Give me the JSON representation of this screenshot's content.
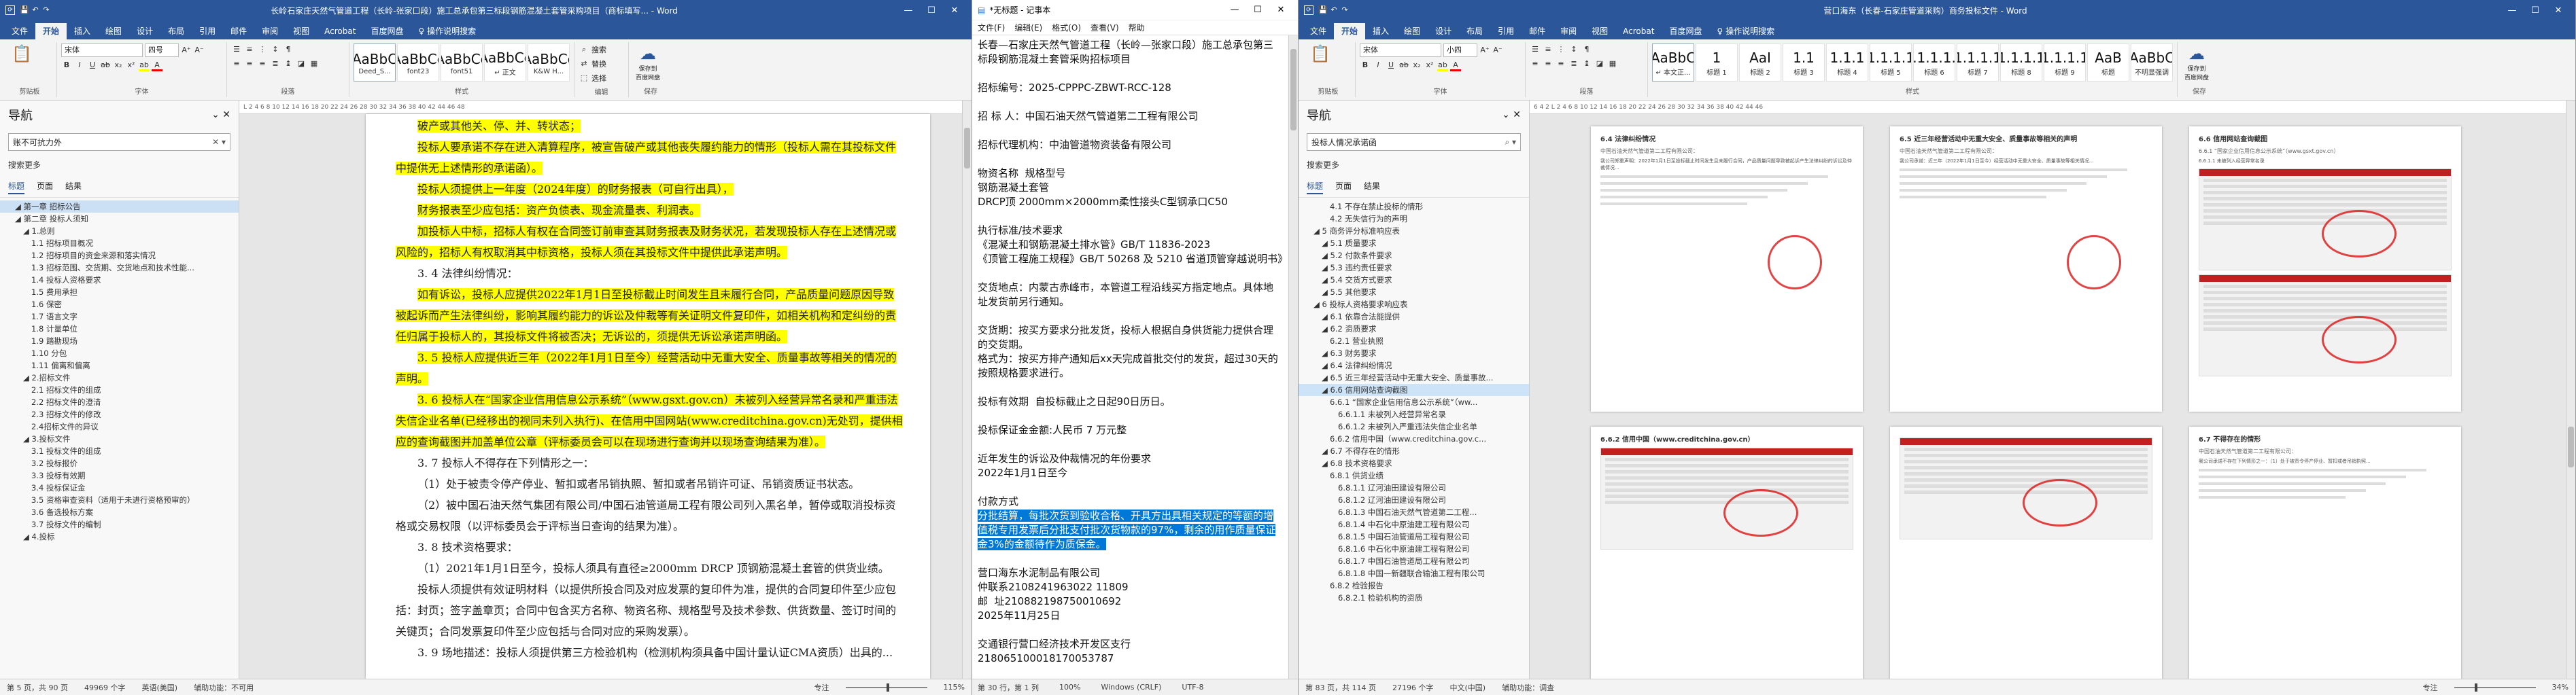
{
  "win1": {
    "title_left": "长岭石家庄天然气管道工程（长岭-张家口段）施工总承包第三标段钢筋混凝土套管采购项目（商标填写...",
    "title_right": "Word",
    "tabs": [
      "文件",
      "开始",
      "插入",
      "绘图",
      "设计",
      "布局",
      "引用",
      "邮件",
      "审阅",
      "视图",
      "Acrobat",
      "百度网盘",
      "♀ 操作说明搜索"
    ],
    "font_name": "宋体",
    "font_size": "四号",
    "styles": [
      {
        "sample": "AaBbC",
        "name": "Deed_S..."
      },
      {
        "sample": "AaBbCc",
        "name": "font23"
      },
      {
        "sample": "AaBbCc",
        "name": "font51"
      },
      {
        "sample": "AaBbCc",
        "name": "↵ 正文"
      },
      {
        "sample": "AaBbCc",
        "name": "K&W H..."
      }
    ],
    "edit": [
      "搜索",
      "替换",
      "选择"
    ],
    "save_label": "保存到\n百度网盘",
    "group_labels": [
      "剪贴板",
      "字体",
      "段落",
      "样式",
      "编辑",
      "保存"
    ],
    "nav": {
      "title": "导航",
      "search_value": "账不可抗力外",
      "search_link": "搜索更多",
      "tabs": [
        "标题",
        "页面",
        "结果"
      ],
      "tree": [
        {
          "t": "第一章 招标公告",
          "lv": 1,
          "sel": true
        },
        {
          "t": "第二章 投标人须知",
          "lv": 1
        },
        {
          "t": "1.总则",
          "lv": 2
        },
        {
          "t": "1.1 招标项目概况",
          "lv": 3
        },
        {
          "t": "1.2 招标项目的资金来源和落实情况",
          "lv": 3
        },
        {
          "t": "1.3 招标范围、交货期、交货地点和技术性能...",
          "lv": 3
        },
        {
          "t": "1.4 投标人资格要求",
          "lv": 3
        },
        {
          "t": "1.5 费用承担",
          "lv": 3
        },
        {
          "t": "1.6 保密",
          "lv": 3
        },
        {
          "t": "1.7 语言文字",
          "lv": 3
        },
        {
          "t": "1.8 计量单位",
          "lv": 3
        },
        {
          "t": "1.9 踏勘现场",
          "lv": 3
        },
        {
          "t": "1.10 分包",
          "lv": 3
        },
        {
          "t": "1.11 偏离和偏离",
          "lv": 3
        },
        {
          "t": "2.招标文件",
          "lv": 2
        },
        {
          "t": "2.1 招标文件的组成",
          "lv": 3
        },
        {
          "t": "2.2 招标文件的澄清",
          "lv": 3
        },
        {
          "t": "2.3 招标文件的修改",
          "lv": 3
        },
        {
          "t": "2.4招标文件的异议",
          "lv": 3
        },
        {
          "t": "3.投标文件",
          "lv": 2
        },
        {
          "t": "3.1 投标文件的组成",
          "lv": 3
        },
        {
          "t": "3.2 投标报价",
          "lv": 3
        },
        {
          "t": "3.3 投标有效期",
          "lv": 3
        },
        {
          "t": "3.4 投标保证金",
          "lv": 3
        },
        {
          "t": "3.5 资格审查资料（适用于未进行资格预审的）",
          "lv": 3
        },
        {
          "t": "3.6 备选投标方案",
          "lv": 3
        },
        {
          "t": "3.7 投标文件的编制",
          "lv": 3
        },
        {
          "t": "4.投标",
          "lv": 2
        }
      ]
    },
    "ruler": "L  2  4  6  8  10  12  14  16  18  20  22  24  26  28  30  32  34  36  38  40  42  44  46  48",
    "paragraphs": [
      {
        "h": "yel",
        "t": "破产或其他关、停、并、转状态；"
      },
      {
        "h": "yel",
        "t": "投标人要承诺不存在进入清算程序，被宣告破产或其他丧失履约能力的情形（投标人需在其投标文件中提供无上述情形的承诺函）。"
      },
      {
        "h": "yel",
        "t": "投标人须提供上一年度（2024年度）的财务报表（可自行出具），"
      },
      {
        "h": "yel",
        "t": "财务报表至少应包括：资产负债表、现金流量表、利润表。"
      },
      {
        "h": "yel",
        "t": "加投标人中标，招标人有权在合同签订前审查其财务报表及财务状况，若发现投标人存在上述情况或风险的，招标人有权取消其中标资格，投标人须在其投标文件中提供此承诺声明。"
      },
      {
        "h": "",
        "t": "3. 4 法律纠纷情况："
      },
      {
        "h": "yel",
        "t": "如有诉讼，投标人应提供2022年1月1日至投标截止时间发生且未履行合同，产品质量问题原因导致被起诉而产生法律纠纷，影响其履约能力的诉讼及仲裁等有关证明文件复印件，如相关机构和定纠纷的责任归属于投标人的，其投标文件将被否决；无诉讼的，须提供无诉讼承诺声明函。"
      },
      {
        "h": "yel",
        "t": "3. 5 投标人应提供近三年（2022年1月1日至今）经营活动中无重大安全、质量事故等相关的情况的声明。"
      },
      {
        "h": "yel",
        "t": "3. 6 投标人在“国家企业信用信息公示系统”（www.gsxt.gov.cn）未被列入经营异常名录和严重违法失信企业名单(已经移出的视同未列入执行)、在信用中国网站(www.creditchina.gov.cn)无处罚，提供相应的查询截图并加盖单位公章（评标委员会可以在现场进行查询并以现场查询结果为准）。"
      },
      {
        "h": "",
        "t": "3. 7 投标人不得存在下列情形之一："
      },
      {
        "h": "",
        "t": "（1）处于被责令停产停业、暂扣或者吊销执照、暂扣或者吊销许可证、吊销资质证书状态。"
      },
      {
        "h": "",
        "t": "（2）被中国石油天然气集团有限公司/中国石油管道局工程有限公司列入黑名单，暂停或取消投标资格或交易权限（以评标委员会于评标当日查询的结果为准）。"
      },
      {
        "h": "",
        "t": "3. 8 技术资格要求："
      },
      {
        "h": "",
        "t": "（1）2021年1月1日至今，投标人须具有直径≥2000mm DRCP 顶钢筋混凝土套管的供货业绩。"
      },
      {
        "h": "",
        "t": "投标人须提供有效证明材料（以提供所投合同及对应发票的复印件为准，提供的合同复印件至少应包括：封页；签字盖章页；合同中包含买方名称、物资名称、规格型号及技术参数、供货数量、签订时间的关键页；合同发票复印件至少应包括与合同对应的采购发票）。"
      },
      {
        "h": "",
        "t": "3. 9 场地描述：投标人须提供第三方检验机构（检测机构须具备中国计量认证CMA资质）出具的..."
      }
    ],
    "status": [
      "第 5 页，共 90 页",
      "49969 个字",
      "英语(美国)",
      "辅助功能：不可用",
      "专注",
      "115%"
    ]
  },
  "win2": {
    "title": "*无标题 - 记事本",
    "menu": [
      "文件(F)",
      "编辑(E)",
      "格式(O)",
      "查看(V)",
      "帮助"
    ],
    "lines": [
      {
        "t": "长春—石家庄天然气管道工程（长岭—张家口段）施工总承包第三标段钢筋混凝土套管采购招标项目"
      },
      {
        "t": ""
      },
      {
        "t": "招标编号：2025-CPPPC-ZBWT-RCC-128"
      },
      {
        "t": ""
      },
      {
        "t": "招 标 人：中国石油天然气管道第二工程有限公司"
      },
      {
        "t": ""
      },
      {
        "t": "招标代理机构：中油管道物资装备有限公司"
      },
      {
        "t": ""
      },
      {
        "t": "物资名称  规格型号"
      },
      {
        "t": "钢筋混凝土套管"
      },
      {
        "t": "DRCP顶 2000mm×2000mm柔性接头C型钢承口C50"
      },
      {
        "t": ""
      },
      {
        "t": "执行标准/技术要求"
      },
      {
        "t": "《混凝土和钢筋混凝土排水管》GB/T 11836-2023"
      },
      {
        "t": "《顶管工程施工规程》GB/T 50268 及 5210 省道顶管穿越说明书》"
      },
      {
        "t": ""
      },
      {
        "t": "交货地点：内蒙古赤峰市，本管道工程沿线买方指定地点。具体地址发货前另行通知。"
      },
      {
        "t": ""
      },
      {
        "t": "交货期：按买方要求分批发货，投标人根据自身供货能力提供合理的交货期。"
      },
      {
        "t": "格式为：按买方排产通知后xx天完成首批交付的发货，超过30天的按照规格要求进行。"
      },
      {
        "t": ""
      },
      {
        "t": "投标有效期  自投标截止之日起90日历日。"
      },
      {
        "t": ""
      },
      {
        "t": "投标保证金金额:人民币 7 万元整"
      },
      {
        "t": ""
      },
      {
        "t": "近年发生的诉讼及仲裁情况的年份要求"
      },
      {
        "t": "2022年1月1日至今"
      },
      {
        "t": ""
      },
      {
        "t": "付款方式"
      },
      {
        "t": "分批结算，每批次货到验收合格、开具方出具相关规定的等额的增值税专用发票后分批支付批次货物款的97%，剩余的用作质量保证金3%的金额待作为质保金。",
        "sel": true
      },
      {
        "t": ""
      },
      {
        "t": "营口海东水泥制品有限公司"
      },
      {
        "t": "仲联系2108241963022 11809"
      },
      {
        "t": "邮  址210882198750010692"
      },
      {
        "t": "2025年11月25日"
      },
      {
        "t": ""
      },
      {
        "t": "交通银行营口经济技术开发区支行"
      },
      {
        "t": "218065100018170053787"
      }
    ],
    "status": [
      "第 30 行，第 1 列",
      "100%",
      "Windows (CRLF)",
      "UTF-8"
    ]
  },
  "win3": {
    "title_left": "营口海东（长春-石家庄管道采购）商务投标文件",
    "title_right": "Word",
    "tabs": [
      "文件",
      "开始",
      "插入",
      "绘图",
      "设计",
      "布局",
      "引用",
      "邮件",
      "审阅",
      "视图",
      "Acrobat",
      "百度网盘",
      "♀ 操作说明搜索"
    ],
    "font_name": "宋体",
    "font_size": "小四",
    "styles": [
      {
        "sample": "AaBbC",
        "name": "↵ 本文正..."
      },
      {
        "sample": "1",
        "name": "标题 1"
      },
      {
        "sample": "AaI",
        "name": "标题 2"
      },
      {
        "sample": "1.1",
        "name": "标题 3"
      },
      {
        "sample": "1.1.1",
        "name": "标题 4"
      },
      {
        "sample": "1.1.1.1",
        "name": "标题 5"
      },
      {
        "sample": "1.1.1.1.1",
        "name": "标题 6"
      },
      {
        "sample": "1.1.1.1.1.1",
        "name": "标题 7"
      },
      {
        "sample": "1.1.1.1",
        "name": "标题 8"
      },
      {
        "sample": "1.1.1.1",
        "name": "标题 9"
      },
      {
        "sample": "AaB",
        "name": "标题"
      },
      {
        "sample": "AaBbC",
        "name": "不明显强调"
      }
    ],
    "nav": {
      "title": "导航",
      "search_value": "投标人情况承诺函",
      "search_link": "搜索更多",
      "tabs": [
        "标题",
        "页面",
        "结果"
      ],
      "tree": [
        {
          "t": "4.1 不存在禁止投标的情形",
          "lv": 3
        },
        {
          "t": "4.2 无失信行为的声明",
          "lv": 3
        },
        {
          "t": "5 商务评分标准响应表",
          "lv": 1
        },
        {
          "t": "5.1 质量要求",
          "lv": 2
        },
        {
          "t": "5.2 付款条件要求",
          "lv": 2
        },
        {
          "t": "5.3 违约责任要求",
          "lv": 2
        },
        {
          "t": "5.4 交货方式要求",
          "lv": 2
        },
        {
          "t": "5.5 其他要求",
          "lv": 2
        },
        {
          "t": "6 投标人资格要求响应表",
          "lv": 1
        },
        {
          "t": "6.1 依靠合法能提供",
          "lv": 2
        },
        {
          "t": "6.2 资质要求",
          "lv": 2
        },
        {
          "t": "6.2.1 营业执照",
          "lv": 3
        },
        {
          "t": "6.3 财务要求",
          "lv": 2
        },
        {
          "t": "6.4 法律纠纷情况",
          "lv": 2
        },
        {
          "t": "6.5 近三年经营活动中无重大安全、质量事故...",
          "lv": 2
        },
        {
          "t": "6.6 信用网站查询截图",
          "lv": 2,
          "hl": true
        },
        {
          "t": "6.6.1 “国家企业信用信息公示系统”（ww...",
          "lv": 3
        },
        {
          "t": "6.6.1.1 未被列入经营异常名录",
          "lv": 4
        },
        {
          "t": "6.6.1.2 未被列入严重违法失信企业名单",
          "lv": 4
        },
        {
          "t": "6.6.2 信用中国（www.creditchina.gov.c...",
          "lv": 3
        },
        {
          "t": "6.7 不得存在的情形",
          "lv": 2
        },
        {
          "t": "6.8 技术资格要求",
          "lv": 2
        },
        {
          "t": "6.8.1 供货业绩",
          "lv": 3
        },
        {
          "t": "6.8.1.1 辽河油田建设有限公司",
          "lv": 4
        },
        {
          "t": "6.8.1.2 辽河油田建设有限公司",
          "lv": 4
        },
        {
          "t": "6.8.1.3 中国石油天然气管道第二工程...",
          "lv": 4
        },
        {
          "t": "6.8.1.4 中石化中原油建工程有限公司",
          "lv": 4
        },
        {
          "t": "6.8.1.5 中国石油管道局工程有限公司",
          "lv": 4
        },
        {
          "t": "6.8.1.6 中石化中原油建工程有限公司",
          "lv": 4
        },
        {
          "t": "6.8.1.7 中国石油管道局工程有限公司",
          "lv": 4
        },
        {
          "t": "6.8.1.8 中国—新疆联合输油工程有限公司",
          "lv": 4
        },
        {
          "t": "6.8.2 检验报告",
          "lv": 3
        },
        {
          "t": "6.8.2.1 检验机构的资质",
          "lv": 4
        }
      ]
    },
    "ruler": "6  4  2  L  2  4  6  8  10  12  14  16  18  20  22  24  26  28  30  32  34  36  38  40  42  44  46",
    "pages": [
      {
        "h": "6.4 法律纠纷情况",
        "sub": "中国石油天然气管道第二工程有限公司：",
        "txt": "我公司郑重声明：2022年1月1日至投标截止时间发生且未履行合同，产品质量问题导致被起诉产生法律纠纷的诉讼及仲裁情况..."
      },
      {
        "h": "6.5 近三年经营活动中无重大安全、质量事故等相关的声明",
        "sub": "中国石油天然气管道第二工程有限公司：",
        "txt": "我公司承诺：近三年（2022年1月1日至今）经营活动中无重大安全、质量事故等相关情况..."
      },
      {
        "h": "6.6 信用网站查询截图",
        "sub": "6.6.1 “国家企业信用信息公示系统”（www.gsxt.gov.cn）",
        "txt": "6.6.1.1 未被列入经营异常名录"
      },
      {
        "h": "6.6.2 信用中国（www.creditchina.gov.cn）",
        "sub": "",
        "txt": ""
      },
      {
        "h": "",
        "sub": "",
        "txt": ""
      },
      {
        "h": "6.7 不得存在的情形",
        "sub": "中国石油天然气管道第二工程有限公司：",
        "txt": "我公司承诺不存在下列情形之一：（1）处于被责令停产停业、暂扣或者吊销执照..."
      }
    ],
    "status": [
      "第 83 页，共 114 页",
      "27196 个字",
      "中文(中国)",
      "辅助功能：调查",
      "专注",
      "34%"
    ]
  }
}
